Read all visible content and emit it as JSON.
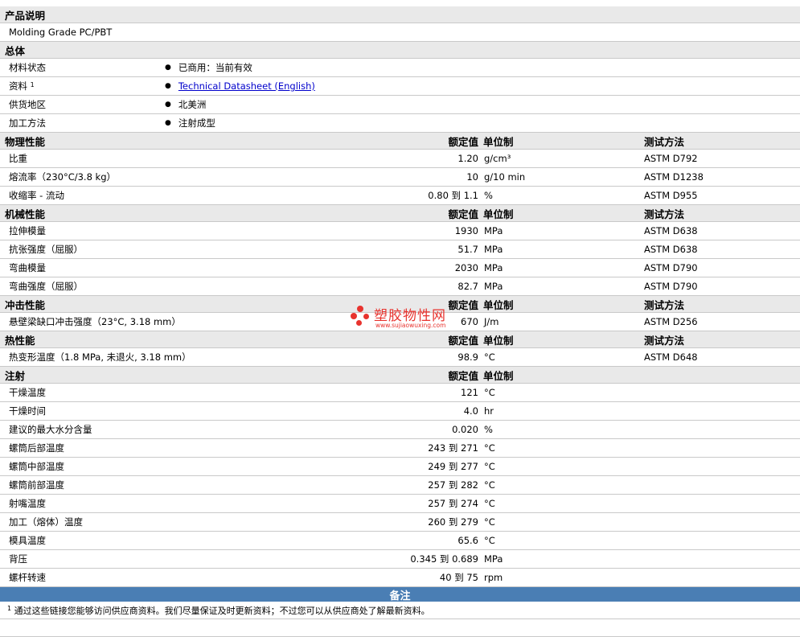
{
  "sections": [
    {
      "type": "text",
      "title": "产品说明",
      "rows": [
        {
          "label": "Molding Grade PC/PBT"
        }
      ]
    },
    {
      "type": "bullets",
      "title": "总体",
      "rows": [
        {
          "label": "材料状态",
          "value": "已商用：当前有效"
        },
        {
          "label": "资料",
          "sup": "1",
          "value": "Technical Datasheet (English)",
          "link": true
        },
        {
          "label": "供货地区",
          "value": "北美洲"
        },
        {
          "label": "加工方法",
          "value": "注射成型"
        }
      ]
    },
    {
      "type": "props",
      "title": "物理性能",
      "head": {
        "value": "额定值",
        "unit": "单位制",
        "test": "测试方法"
      },
      "rows": [
        {
          "label": "比重",
          "value": "1.20",
          "unit": "g/cm³",
          "test": "ASTM D792"
        },
        {
          "label": "熔流率（230°C/3.8 kg）",
          "value": "10",
          "unit": "g/10 min",
          "test": "ASTM D1238"
        },
        {
          "label": "收缩率 - 流动",
          "value": "0.80 到 1.1",
          "unit": "%",
          "test": "ASTM D955"
        }
      ]
    },
    {
      "type": "props",
      "title": "机械性能",
      "head": {
        "value": "额定值",
        "unit": "单位制",
        "test": "测试方法"
      },
      "rows": [
        {
          "label": "拉伸模量",
          "value": "1930",
          "unit": "MPa",
          "test": "ASTM D638"
        },
        {
          "label": "抗张强度（屈服）",
          "value": "51.7",
          "unit": "MPa",
          "test": "ASTM D638"
        },
        {
          "label": "弯曲模量",
          "value": "2030",
          "unit": "MPa",
          "test": "ASTM D790"
        },
        {
          "label": "弯曲强度（屈服）",
          "value": "82.7",
          "unit": "MPa",
          "test": "ASTM D790"
        }
      ]
    },
    {
      "type": "props",
      "title": "冲击性能",
      "head": {
        "value": "额定值",
        "unit": "单位制",
        "test": "测试方法"
      },
      "rows": [
        {
          "label": "悬壁梁缺口冲击强度（23°C, 3.18 mm）",
          "value": "670",
          "unit": "J/m",
          "test": "ASTM D256"
        }
      ]
    },
    {
      "type": "props",
      "title": "热性能",
      "head": {
        "value": "额定值",
        "unit": "单位制",
        "test": "测试方法"
      },
      "rows": [
        {
          "label": "热变形温度（1.8 MPa, 未退火, 3.18 mm）",
          "value": "98.9",
          "unit": "°C",
          "test": "ASTM D648"
        }
      ]
    },
    {
      "type": "props",
      "title": "注射",
      "head": {
        "value": "额定值",
        "unit": "单位制",
        "test": ""
      },
      "rows": [
        {
          "label": "干燥温度",
          "value": "121",
          "unit": "°C",
          "test": ""
        },
        {
          "label": "干燥时间",
          "value": "4.0",
          "unit": "hr",
          "test": ""
        },
        {
          "label": "建议的最大水分含量",
          "value": "0.020",
          "unit": "%",
          "test": ""
        },
        {
          "label": "螺筒后部温度",
          "value": "243 到 271",
          "unit": "°C",
          "test": ""
        },
        {
          "label": "螺筒中部温度",
          "value": "249 到 277",
          "unit": "°C",
          "test": ""
        },
        {
          "label": "螺筒前部温度",
          "value": "257 到 282",
          "unit": "°C",
          "test": ""
        },
        {
          "label": "射嘴温度",
          "value": "257 到 274",
          "unit": "°C",
          "test": ""
        },
        {
          "label": "加工（熔体）温度",
          "value": "260 到 279",
          "unit": "°C",
          "test": ""
        },
        {
          "label": "模具温度",
          "value": "65.6",
          "unit": "°C",
          "test": ""
        },
        {
          "label": "背压",
          "value": "0.345 到 0.689",
          "unit": "MPa",
          "test": ""
        },
        {
          "label": "螺杆转速",
          "value": "40 到 75",
          "unit": "rpm",
          "test": ""
        }
      ]
    }
  ],
  "notes": {
    "title": "备注",
    "items": [
      {
        "sup": "1",
        "text": "通过这些链接您能够访问供应商资料。我们尽量保证及时更新资料；不过您可以从供应商处了解最新资料。"
      }
    ]
  },
  "watermark": {
    "name": "塑胶物性网",
    "url": "www.sujiaowuxing.com"
  },
  "colors": {
    "section_bg": "#e9e9e9",
    "notes_bar": "#4a7eb4",
    "link": "#0000cc",
    "watermark": "#e8332e"
  }
}
